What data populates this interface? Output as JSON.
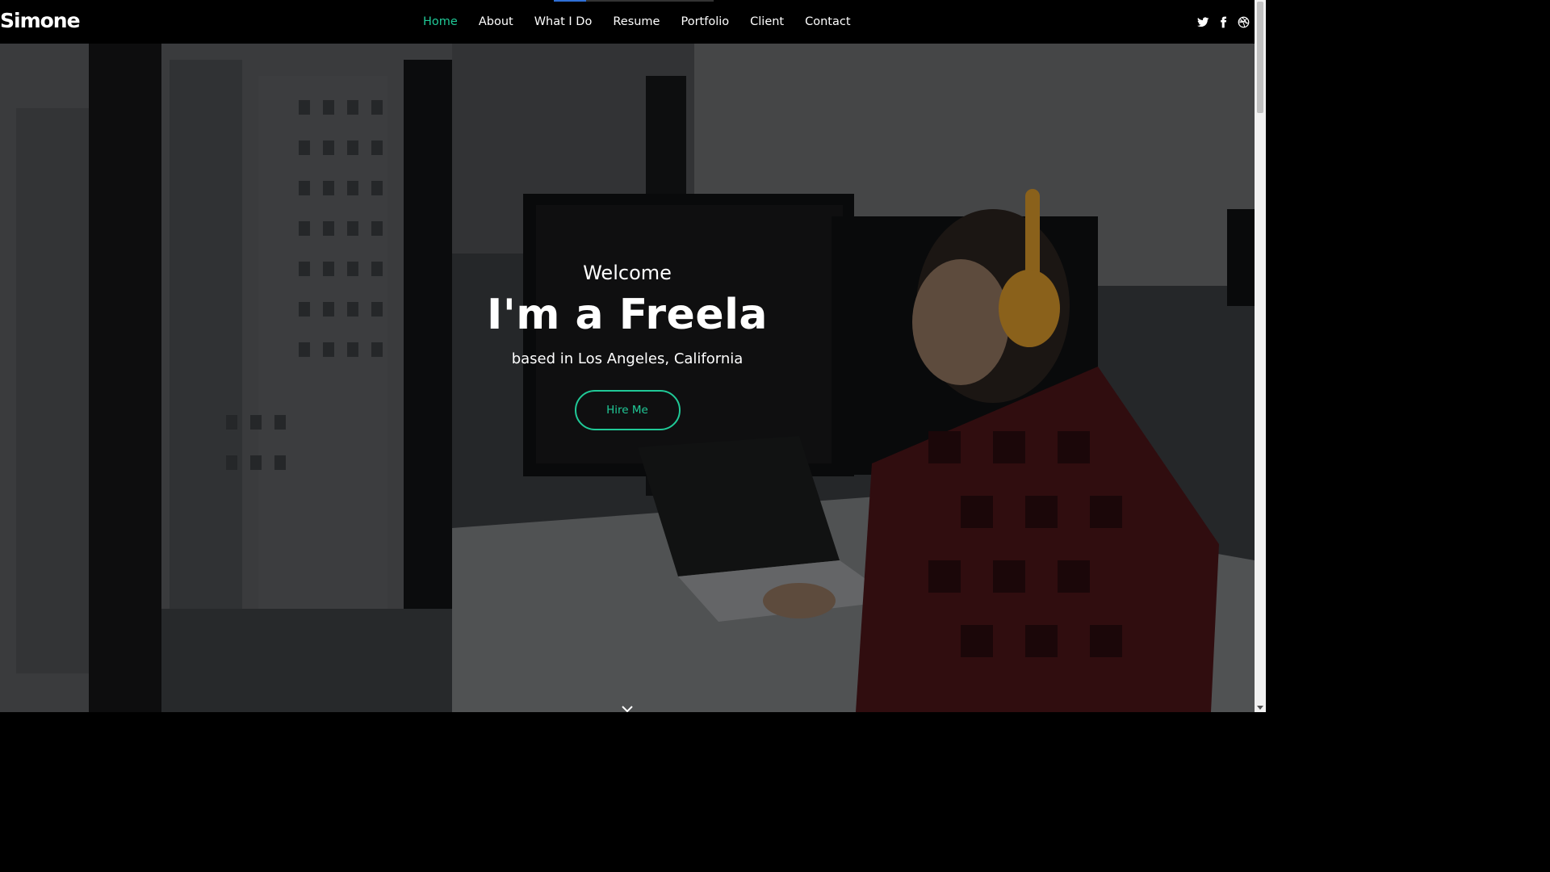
{
  "header": {
    "logo": "Simone",
    "nav": [
      {
        "label": "Home",
        "active": true
      },
      {
        "label": "About"
      },
      {
        "label": "What I Do"
      },
      {
        "label": "Resume"
      },
      {
        "label": "Portfolio"
      },
      {
        "label": "Client"
      },
      {
        "label": "Contact"
      }
    ],
    "social": [
      "twitter-icon",
      "facebook-icon",
      "dribbble-icon"
    ]
  },
  "hero": {
    "welcome": "Welcome",
    "headline": "I'm a Freela",
    "subtitle": "based in Los Angeles, California",
    "button": "Hire Me",
    "scroll_icon": "chevron-down-icon"
  },
  "colors": {
    "accent": "#20c997",
    "header_bg": "#000000",
    "loader": "#2f6fd6"
  }
}
